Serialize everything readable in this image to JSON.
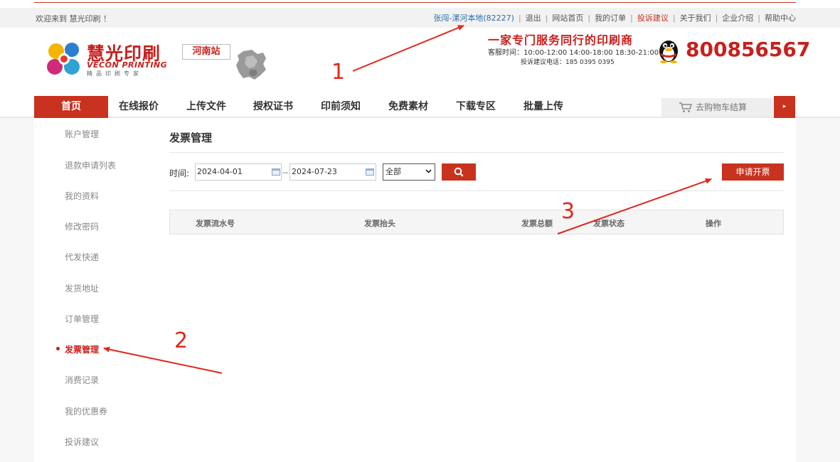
{
  "topbar": {
    "welcome": "欢迎来到 慧光印刷 ！",
    "user_link": "张闯-漯河本地(82227)",
    "logout": "退出",
    "home": "网站首页",
    "orders": "我的订单",
    "complaint": "投诉建议",
    "about": "关于我们",
    "company": "企业介绍",
    "help": "帮助中心"
  },
  "header": {
    "logo_cn": "慧光印刷",
    "logo_en": "VECON PRINTING",
    "logo_tag": "精品印刷专家",
    "station": "河南站",
    "slogan": "一家专门服务同行的印刷商",
    "hours": "客服时间：10:00-12:00  14:00-18:00  18:30-21:00",
    "complaint_tel": "投诉建议电话：185 0395 0395",
    "phone": "800856567"
  },
  "nav": {
    "items": [
      {
        "label": "首页"
      },
      {
        "label": "在线报价"
      },
      {
        "label": "上传文件"
      },
      {
        "label": "授权证书"
      },
      {
        "label": "印前须知"
      },
      {
        "label": "免费素材"
      },
      {
        "label": "下载专区"
      },
      {
        "label": "批量上传"
      }
    ],
    "cart": "去购物车结算",
    "cart_arrow": "▸"
  },
  "sidebar": {
    "items": [
      {
        "label": "账户管理"
      },
      {
        "label": "退款申请列表"
      },
      {
        "label": "我的资料"
      },
      {
        "label": "修改密码"
      },
      {
        "label": "代发快递"
      },
      {
        "label": "发货地址"
      },
      {
        "label": "订单管理"
      },
      {
        "label": "发票管理"
      },
      {
        "label": "消费记录"
      },
      {
        "label": "我的优惠券"
      },
      {
        "label": "投诉建议"
      }
    ]
  },
  "main": {
    "title": "发票管理",
    "filter": {
      "time_label": "时间:",
      "start_date": "2024-04-01",
      "date_sep": "--",
      "end_date": "2024-07-23",
      "status_value": "全部"
    },
    "apply_button": "申请开票",
    "table": {
      "headers": [
        "发票流水号",
        "发票抬头",
        "发票总额",
        "发票状态",
        "操作"
      ]
    }
  },
  "annotations": {
    "labels": [
      "1",
      "2",
      "3"
    ],
    "color": "#e0281b"
  },
  "colors": {
    "brand_red": "#c8321f",
    "link_blue": "#2a6ca8"
  }
}
